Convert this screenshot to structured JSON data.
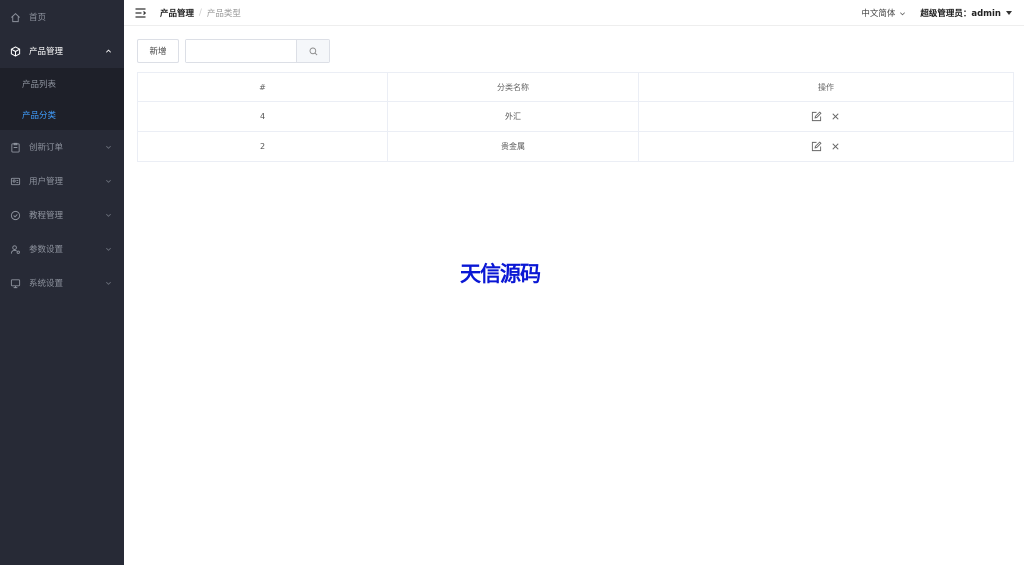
{
  "sidebar": {
    "home_label": "首页",
    "product_label": "产品管理",
    "product_items": [
      {
        "label": "产品列表"
      },
      {
        "label": "产品分类"
      }
    ],
    "orders_label": "创新订单",
    "users_label": "用户管理",
    "tutorial_label": "教程管理",
    "params_label": "参数设置",
    "system_label": "系统设置",
    "active_color": "#409eff",
    "bg_color": "#272a36"
  },
  "header": {
    "breadcrumb_parent": "产品管理",
    "breadcrumb_sep": "/",
    "breadcrumb_current": "产品类型",
    "language": "中文简体",
    "user": "超级管理员：admin"
  },
  "toolbar": {
    "add_label": "新增",
    "search_placeholder": "",
    "search_value": ""
  },
  "table": {
    "headers": [
      "#",
      "分类名称",
      "操作"
    ],
    "rows": [
      {
        "id": "4",
        "name": "外汇"
      },
      {
        "id": "2",
        "name": "贵金属"
      }
    ]
  },
  "watermark": {
    "text": "天信源码",
    "color": "#0a17d4"
  }
}
